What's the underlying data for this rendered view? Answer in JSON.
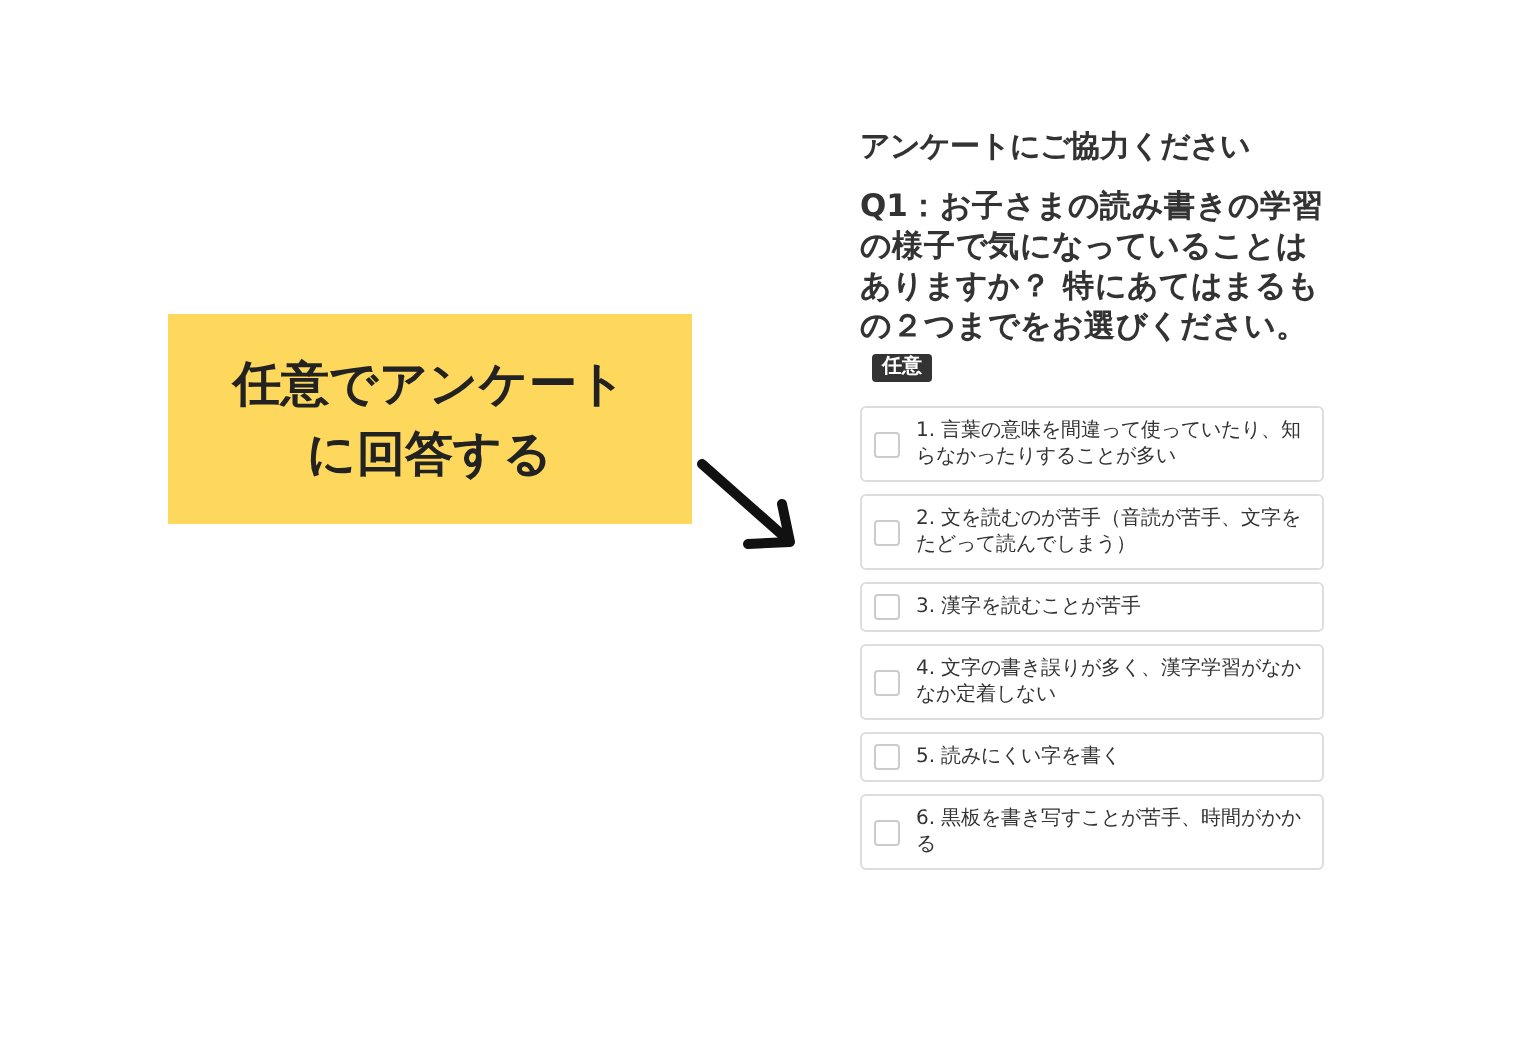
{
  "callout": {
    "text": "任意でアンケートに回答する"
  },
  "survey": {
    "title": "アンケートにご協力ください",
    "question": "Q1：お子さまの読み書きの学習の様子で気になっていることはありますか？ 特にあてはまるもの２つまでをお選びください。",
    "badge": "任意",
    "options": [
      {
        "label": "1. 言葉の意味を間違って使っていたり、知らなかったりすることが多い",
        "checked": false
      },
      {
        "label": "2. 文を読むのが苦手（音読が苦手、文字をたどって読んでしまう）",
        "checked": false
      },
      {
        "label": "3. 漢字を読むことが苦手",
        "checked": false
      },
      {
        "label": "4. 文字の書き誤りが多く、漢字学習がなかなか定着しない",
        "checked": false
      },
      {
        "label": "5. 読みにくい字を書く",
        "checked": false
      },
      {
        "label": "6. 黒板を書き写すことが苦手、時間がかかる",
        "checked": false
      }
    ]
  }
}
